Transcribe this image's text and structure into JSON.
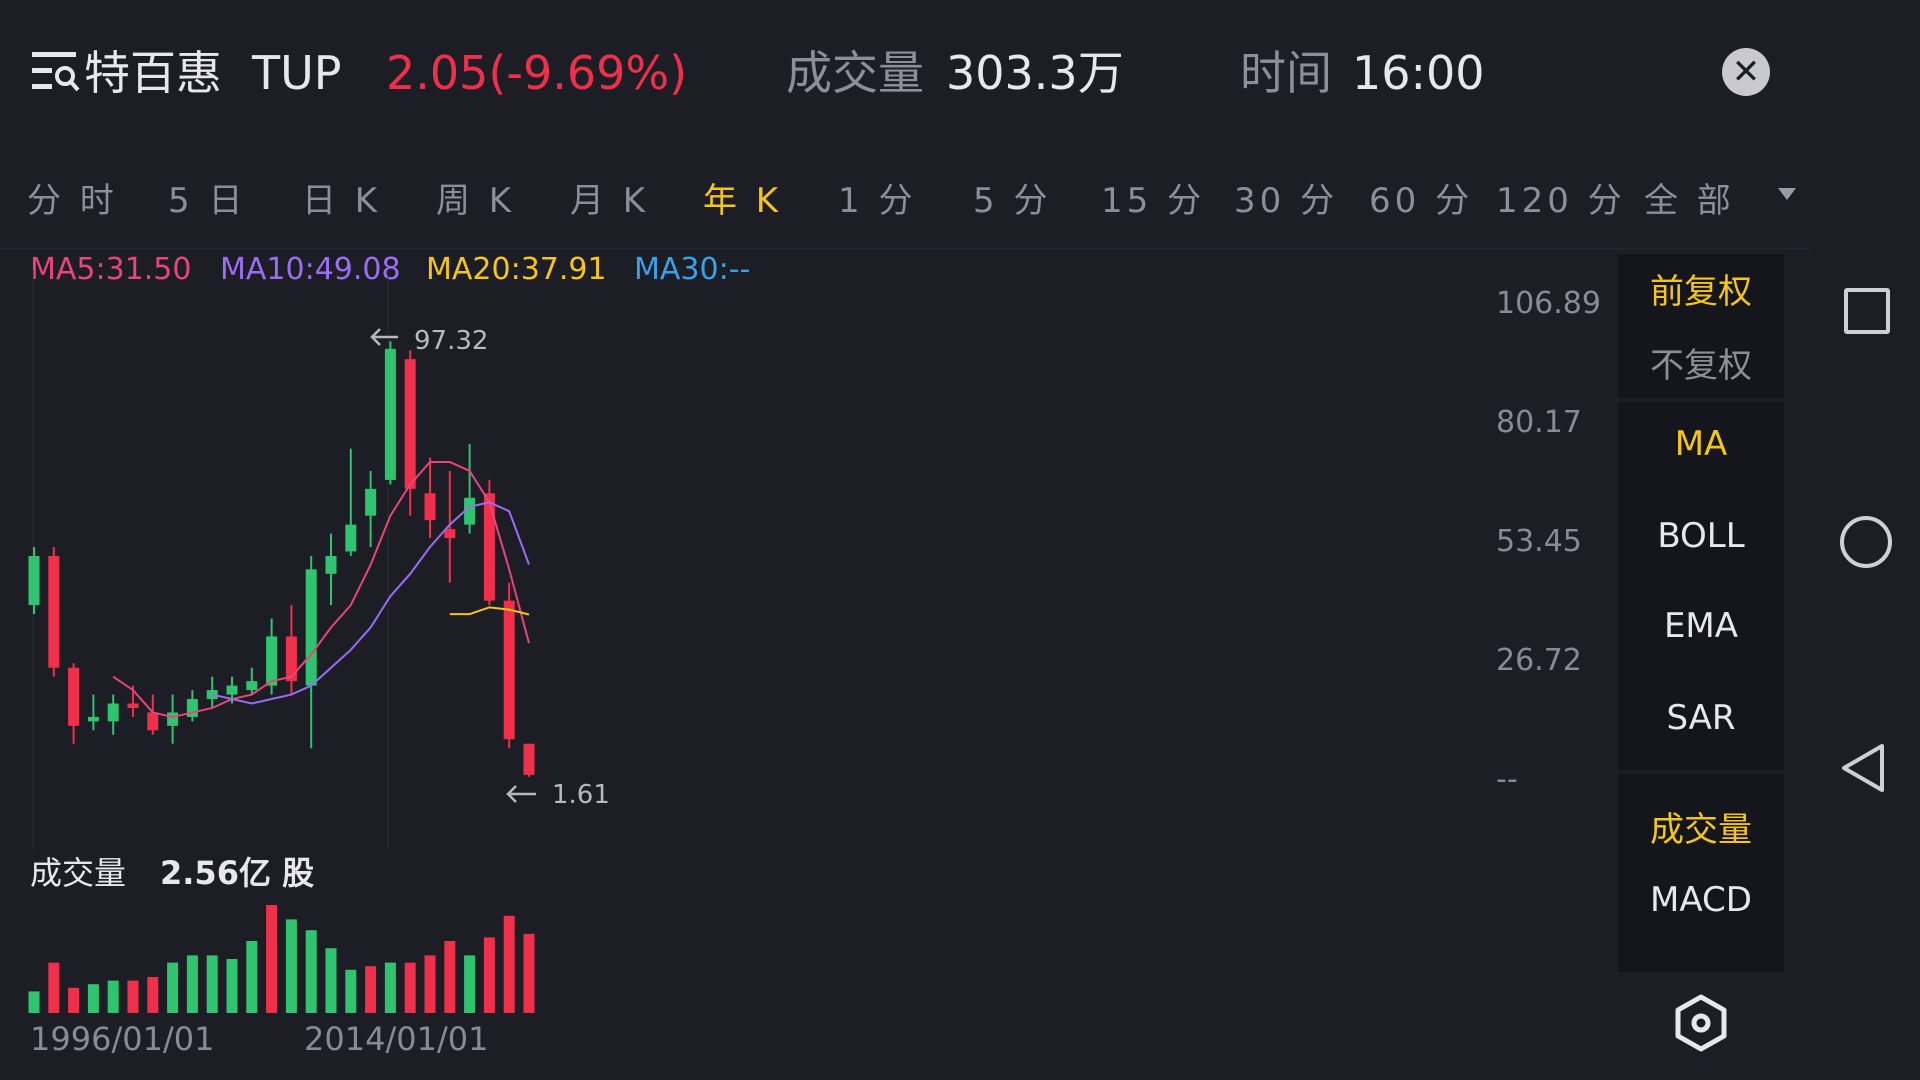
{
  "header": {
    "stock_name": "特百惠",
    "ticker": "TUP",
    "price_change": "2.05(-9.69%)",
    "volume_label": "成交量",
    "volume_value": "303.3万",
    "time_label": "时间",
    "time_value": "16:00",
    "close_icon": "close-icon"
  },
  "tabs": [
    {
      "label": "分 时",
      "active": false
    },
    {
      "label": "5 日",
      "active": false
    },
    {
      "label": "日 K",
      "active": false
    },
    {
      "label": "周 K",
      "active": false
    },
    {
      "label": "月 K",
      "active": false
    },
    {
      "label": "年 K",
      "active": true
    },
    {
      "label": "1 分",
      "active": false
    },
    {
      "label": "5 分",
      "active": false
    },
    {
      "label": "15 分",
      "active": false
    },
    {
      "label": "30 分",
      "active": false
    },
    {
      "label": "60 分",
      "active": false
    },
    {
      "label": "120 分",
      "active": false
    },
    {
      "label": "全 部",
      "active": false
    }
  ],
  "ma_legend": {
    "ma5": "MA5:31.50",
    "ma10": "MA10:49.08",
    "ma20": "MA20:37.91",
    "ma30": "MA30:--"
  },
  "y_axis": [
    "106.89",
    "80.17",
    "53.45",
    "26.72",
    "--"
  ],
  "price_notes": {
    "high": "97.32",
    "low": "1.61"
  },
  "volume_section": {
    "label": "成交量",
    "value": "2.56亿 股"
  },
  "dates": [
    "1996/01/01",
    "2014/01/01"
  ],
  "right_panel": {
    "adjust_forward": "前复权",
    "adjust_none": "不复权",
    "indicators": [
      "MA",
      "BOLL",
      "EMA",
      "SAR"
    ],
    "sub_indicators": [
      "成交量",
      "MACD"
    ],
    "settings_icon": "settings-icon"
  },
  "colors": {
    "up": "#2fc46f",
    "down": "#f0304a",
    "active_tab": "#f5c518",
    "ma5": "#e8457a",
    "ma10": "#9b6cf4",
    "ma20": "#f5c518",
    "ma30": "#3aa0e8",
    "background": "#1d1d26"
  },
  "chart_data": {
    "type": "candlestick",
    "title": "",
    "y_range": [
      0,
      106.89
    ],
    "candles": [
      {
        "o": 40,
        "c": 51,
        "h": 53,
        "l": 38,
        "up": true
      },
      {
        "o": 51,
        "c": 26,
        "h": 53,
        "l": 24,
        "up": false
      },
      {
        "o": 26,
        "c": 13,
        "h": 27,
        "l": 9,
        "up": false
      },
      {
        "o": 14,
        "c": 15,
        "h": 20,
        "l": 12,
        "up": true
      },
      {
        "o": 14,
        "c": 18,
        "h": 20,
        "l": 11,
        "up": true
      },
      {
        "o": 18,
        "c": 17,
        "h": 22,
        "l": 15,
        "up": false
      },
      {
        "o": 16,
        "c": 12,
        "h": 20,
        "l": 11,
        "up": false
      },
      {
        "o": 13,
        "c": 16,
        "h": 20,
        "l": 9,
        "up": true
      },
      {
        "o": 15,
        "c": 19,
        "h": 21,
        "l": 14,
        "up": true
      },
      {
        "o": 19,
        "c": 21,
        "h": 24,
        "l": 17,
        "up": true
      },
      {
        "o": 20,
        "c": 22,
        "h": 24,
        "l": 18,
        "up": true
      },
      {
        "o": 21,
        "c": 23,
        "h": 26,
        "l": 20,
        "up": true
      },
      {
        "o": 22,
        "c": 33,
        "h": 37,
        "l": 20,
        "up": true
      },
      {
        "o": 33,
        "c": 23,
        "h": 40,
        "l": 20,
        "up": false
      },
      {
        "o": 22,
        "c": 48,
        "h": 51,
        "l": 8,
        "up": true
      },
      {
        "o": 47,
        "c": 51,
        "h": 56,
        "l": 40,
        "up": true
      },
      {
        "o": 52,
        "c": 58,
        "h": 75,
        "l": 51,
        "up": true
      },
      {
        "o": 60,
        "c": 66,
        "h": 70,
        "l": 53,
        "up": true
      },
      {
        "o": 68,
        "c": 97.32,
        "h": 99,
        "l": 67,
        "up": true
      },
      {
        "o": 95,
        "c": 66,
        "h": 97,
        "l": 60,
        "up": false
      },
      {
        "o": 65,
        "c": 59,
        "h": 73,
        "l": 55,
        "up": false
      },
      {
        "o": 57,
        "c": 55,
        "h": 70,
        "l": 45,
        "up": false
      },
      {
        "o": 58,
        "c": 64,
        "h": 76,
        "l": 56,
        "up": true
      },
      {
        "o": 65,
        "c": 41,
        "h": 68,
        "l": 40,
        "up": false
      },
      {
        "o": 41,
        "c": 10,
        "h": 45,
        "l": 8,
        "up": false
      },
      {
        "o": 9,
        "c": 2.05,
        "h": 9,
        "l": 1.61,
        "up": false
      }
    ],
    "ma_series": [
      {
        "name": "MA5",
        "values": [
          null,
          null,
          null,
          null,
          24,
          21,
          16,
          15,
          16,
          17,
          19,
          20,
          23,
          24,
          29,
          35,
          40,
          49,
          60,
          67,
          72,
          72,
          70,
          63,
          48,
          31.5
        ]
      },
      {
        "name": "MA10",
        "values": [
          null,
          null,
          null,
          null,
          null,
          null,
          null,
          null,
          null,
          20,
          19,
          18,
          19,
          20,
          22,
          26,
          30,
          35,
          42,
          47,
          53,
          58,
          62,
          63,
          61,
          49.08
        ]
      },
      {
        "name": "MA20",
        "values": [
          null,
          null,
          null,
          null,
          null,
          null,
          null,
          null,
          null,
          null,
          null,
          null,
          null,
          null,
          null,
          null,
          null,
          null,
          null,
          null,
          null,
          38,
          38,
          39.5,
          39,
          37.91
        ]
      }
    ],
    "volume": [
      6,
      14,
      7,
      8,
      9,
      9,
      10,
      14,
      16,
      16,
      15,
      20,
      30,
      26,
      23,
      18,
      12,
      13,
      14,
      14,
      16,
      20,
      16,
      21,
      27,
      22
    ],
    "volume_up": [
      true,
      false,
      false,
      true,
      true,
      false,
      false,
      true,
      true,
      true,
      true,
      true,
      false,
      true,
      true,
      true,
      true,
      false,
      true,
      false,
      false,
      false,
      true,
      false,
      false,
      false
    ]
  }
}
